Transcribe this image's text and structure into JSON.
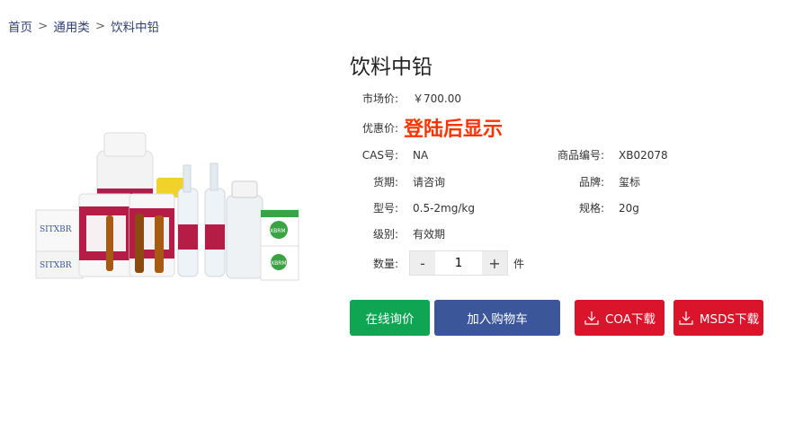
{
  "breadcrumb": {
    "home": "首页",
    "category": "通用类",
    "current": "饮料中铅",
    "separator": ">"
  },
  "product": {
    "title": "饮料中铅",
    "market_price_label": "市场价:",
    "market_price": "￥700.00",
    "promo_label": "优惠价:",
    "promo_text": "登陆后显示",
    "cas_label": "CAS号:",
    "cas": "NA",
    "sku_label": "商品编号:",
    "sku": "XB02078",
    "lead_time_label": "货期:",
    "lead_time": "请咨询",
    "brand_label": "品牌:",
    "brand": "玺标",
    "model_label": "型号:",
    "model": "0.5-2mg/kg",
    "spec_label": "规格:",
    "spec": "20g",
    "grade_label": "级别:",
    "grade": "有效期",
    "quantity_label": "数量:",
    "quantity": "1",
    "unit": "件",
    "minus": "-",
    "plus": "+"
  },
  "actions": {
    "inquire": "在线询价",
    "cart": "加入购物车",
    "coa": "COA下载",
    "msds": "MSDS下载"
  },
  "image_text": {
    "brand_left": "SITXBR",
    "brand_right": "XBRM"
  },
  "colors": {
    "green": "#0fa553",
    "blue": "#3b5699",
    "red": "#d9142b",
    "promo": "#ff3300",
    "link": "#2e3f6e"
  }
}
